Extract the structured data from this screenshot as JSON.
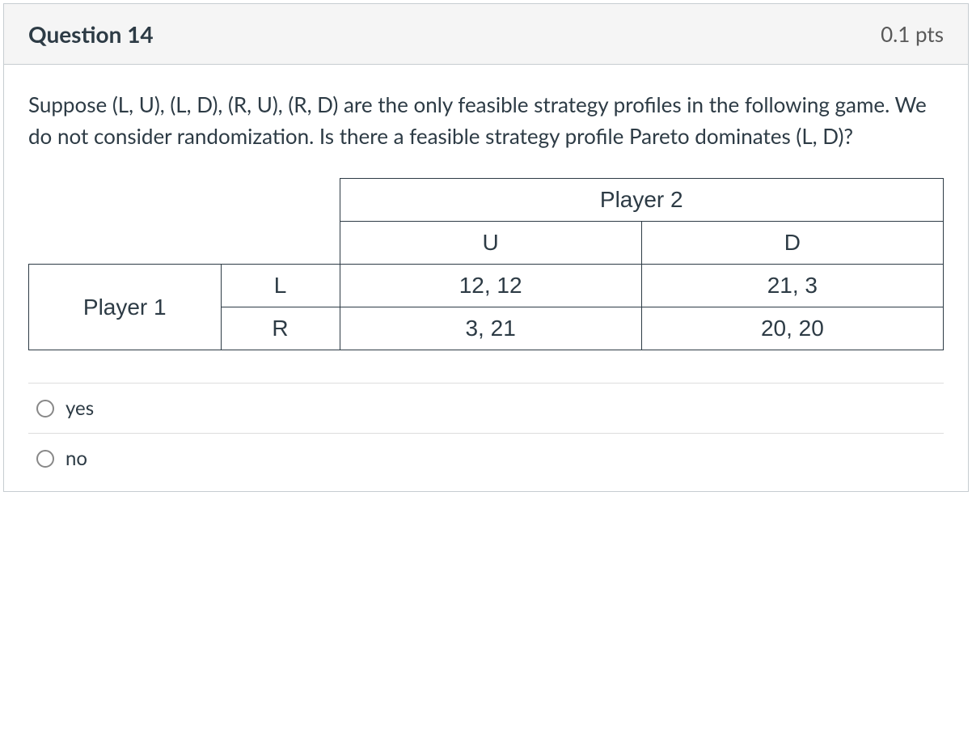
{
  "header": {
    "title": "Question 14",
    "points": "0.1 pts"
  },
  "question": {
    "text": "Suppose (L, U), (L, D), (R, U), (R, D) are the only feasible strategy profiles in the following game. We do not consider randomization. Is there a feasible strategy profile Pareto dominates (L, D)?"
  },
  "game_table": {
    "player2_label": "Player 2",
    "player1_label": "Player 1",
    "col_headers": [
      "U",
      "D"
    ],
    "row_headers": [
      "L",
      "R"
    ],
    "payoffs": [
      [
        "12, 12",
        "21, 3"
      ],
      [
        "3, 21",
        "20, 20"
      ]
    ]
  },
  "answers": {
    "options": [
      {
        "label": "yes"
      },
      {
        "label": "no"
      }
    ]
  }
}
